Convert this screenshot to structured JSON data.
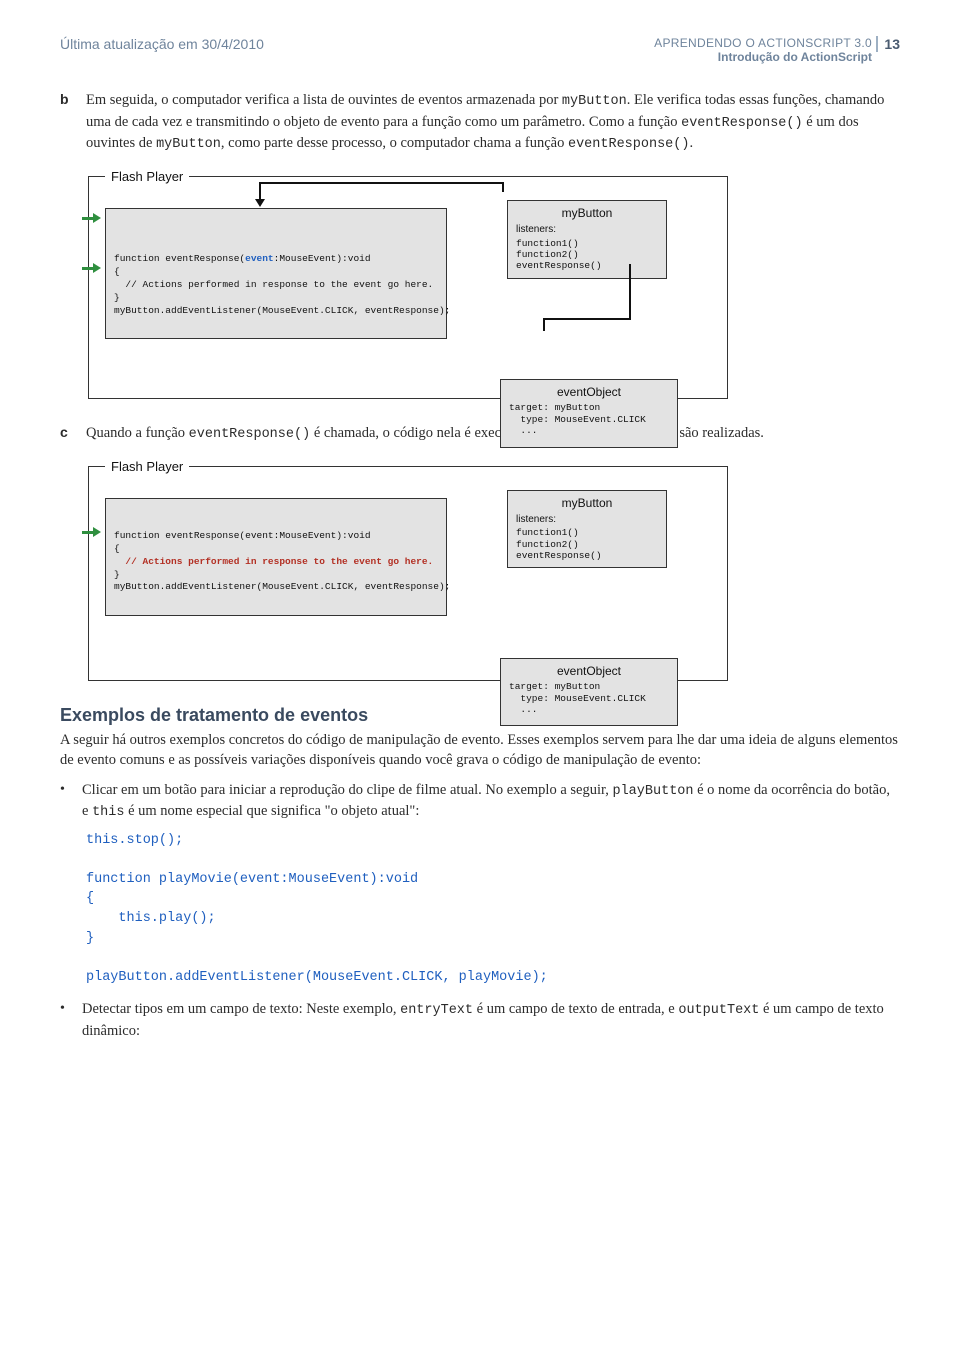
{
  "header": {
    "last_update": "Última atualização em 30/4/2010",
    "product_line": "APRENDENDO O ACTIONSCRIPT 3.0",
    "chapter": "Introdução do ActionScript",
    "page_number": "13"
  },
  "step_b": {
    "marker": "b",
    "text_1": "Em seguida, o computador verifica a lista de ouvintes de eventos armazenada por ",
    "code_1": "myButton",
    "text_2": ". Ele verifica todas essas funções, chamando uma de cada vez e transmitindo o objeto de evento para a função como um parâmetro. Como a função ",
    "code_2": "eventResponse()",
    "text_3": " é um dos ouvintes de ",
    "code_3": "myButton",
    "text_4": ", como parte desse processo, o computador chama a função ",
    "code_4": "eventResponse()",
    "text_5": "."
  },
  "diagram": {
    "legend": "Flash Player",
    "code_line1": "function eventResponse(",
    "code_event_kw": "event",
    "code_line1b": ":MouseEvent):void",
    "code_line2": "{",
    "code_line3": "  // Actions performed in response to the event go here.",
    "code_line4": "}",
    "code_line5": "myButton.addEventListener(MouseEvent.CLICK, eventResponse);",
    "mybutton": {
      "title": "myButton",
      "subtitle": "listeners:",
      "l1": "function1()",
      "l2": "function2()",
      "l3": "eventResponse()"
    },
    "eventobj": {
      "title": "eventObject",
      "row1": "target: myButton",
      "row2": "  type: MouseEvent.CLICK",
      "row3": "  ..."
    }
  },
  "step_c": {
    "marker": "c",
    "text_1": "Quando a função ",
    "code_1": "eventResponse()",
    "text_2": " é chamada, o código nela é executado e as ações especificadas são realizadas."
  },
  "diagram2": {
    "legend": "Flash Player",
    "code_line1": "function eventResponse(event:MouseEvent):void",
    "code_line2": "{",
    "code_line3_hl": "  // Actions performed in response to the event go here.",
    "code_line4": "}",
    "code_line5": "myButton.addEventListener(MouseEvent.CLICK, eventResponse);"
  },
  "examples": {
    "heading": "Exemplos de tratamento de eventos",
    "intro": "A seguir há outros exemplos concretos do código de manipulação de evento. Esses exemplos servem para lhe dar uma ideia de alguns elementos de evento comuns e as possíveis variações disponíveis quando você grava o código de manipulação de evento:",
    "bullet1_a": "Clicar em um botão para iniciar a reprodução do clipe de filme atual. No exemplo a seguir, ",
    "bullet1_code1": "playButton",
    "bullet1_b": " é o nome da ocorrência do botão, e ",
    "bullet1_code2": "this",
    "bullet1_c": " é um nome especial que significa \"o objeto atual\":",
    "code1": "this.stop();\n\nfunction playMovie(event:MouseEvent):void\n{\n    this.play();\n}\n\nplayButton.addEventListener(MouseEvent.CLICK, playMovie);",
    "bullet2_a": "Detectar tipos em um campo de texto: Neste exemplo, ",
    "bullet2_code1": "entryText",
    "bullet2_b": " é um campo de texto de entrada, e ",
    "bullet2_code2": "outputText",
    "bullet2_c": " é um campo de texto dinâmico:"
  }
}
